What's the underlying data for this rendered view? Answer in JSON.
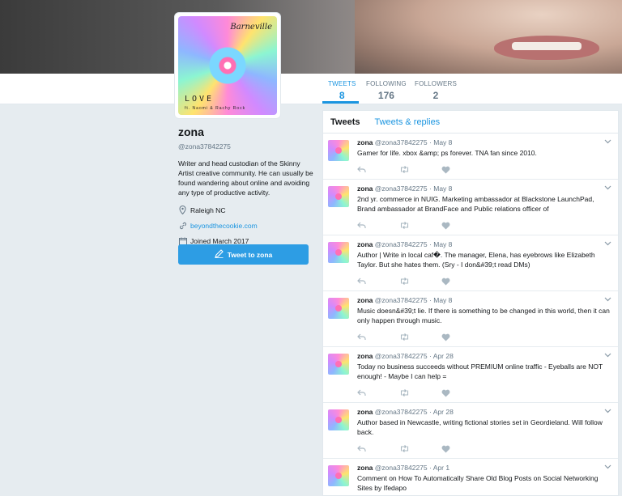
{
  "header": {
    "nav": [
      {
        "label": "TWEETS",
        "value": "8"
      },
      {
        "label": "FOLLOWING",
        "value": "176"
      },
      {
        "label": "FOLLOWERS",
        "value": "2"
      }
    ]
  },
  "avatar": {
    "text_top": "Barneville",
    "text_love": "LOVE",
    "text_ft": "ft. Naomi & Rachy Rock"
  },
  "profile": {
    "name": "zona",
    "handle": "@zona37842275",
    "bio": "Writer and head custodian of the Skinny Artist creative community. He can usually be found wandering about online and avoiding any type of productive activity.",
    "location": "Raleigh NC",
    "website": "beyondthecookie.com",
    "joined": "Joined March 2017",
    "tweet_to_label": "Tweet to zona"
  },
  "timeline": {
    "tabs": [
      {
        "label": "Tweets"
      },
      {
        "label": "Tweets & replies"
      }
    ],
    "tweets": [
      {
        "name": "zona",
        "handle": "@zona37842275",
        "time": "May 8",
        "text": "Gamer for life. xbox &amp; ps forever. TNA fan since 2010."
      },
      {
        "name": "zona",
        "handle": "@zona37842275",
        "time": "May 8",
        "text": "2nd yr. commerce in NUIG. Marketing ambassador at Blackstone LaunchPad, Brand ambassador at BrandFace and Public relations officer of"
      },
      {
        "name": "zona",
        "handle": "@zona37842275",
        "time": "May 8",
        "text": "Author | Write in local caf�. The manager, Elena, has eyebrows like Elizabeth Taylor. But she hates them.  (Sry - I don&#39;t read DMs)"
      },
      {
        "name": "zona",
        "handle": "@zona37842275",
        "time": "May 8",
        "text": "Music doesn&#39;t lie. If there is something to be changed in this world, then it can only happen through music."
      },
      {
        "name": "zona",
        "handle": "@zona37842275",
        "time": "Apr 28",
        "text": "Today no business succeeds without PREMIUM online traffic - Eyeballs are NOT enough! - Maybe I can help ="
      },
      {
        "name": "zona",
        "handle": "@zona37842275",
        "time": "Apr 28",
        "text": "Author based in Newcastle, writing fictional stories set in Geordieland. Will follow back."
      },
      {
        "name": "zona",
        "handle": "@zona37842275",
        "time": "Apr 1",
        "text": "Comment on How To Automatically Share Old Blog Posts on Social Networking Sites by Ifedapo"
      }
    ]
  },
  "colors": {
    "accent": "#1b95e0",
    "button": "#2d9de4",
    "background": "#e6ecf0"
  },
  "icons": {
    "location": "map-pin-icon",
    "website": "link-icon",
    "joined": "calendar-icon",
    "tweet_to": "compose-icon",
    "reply": "reply-icon",
    "retweet": "retweet-icon",
    "like": "heart-icon",
    "caret": "chevron-down-icon"
  }
}
